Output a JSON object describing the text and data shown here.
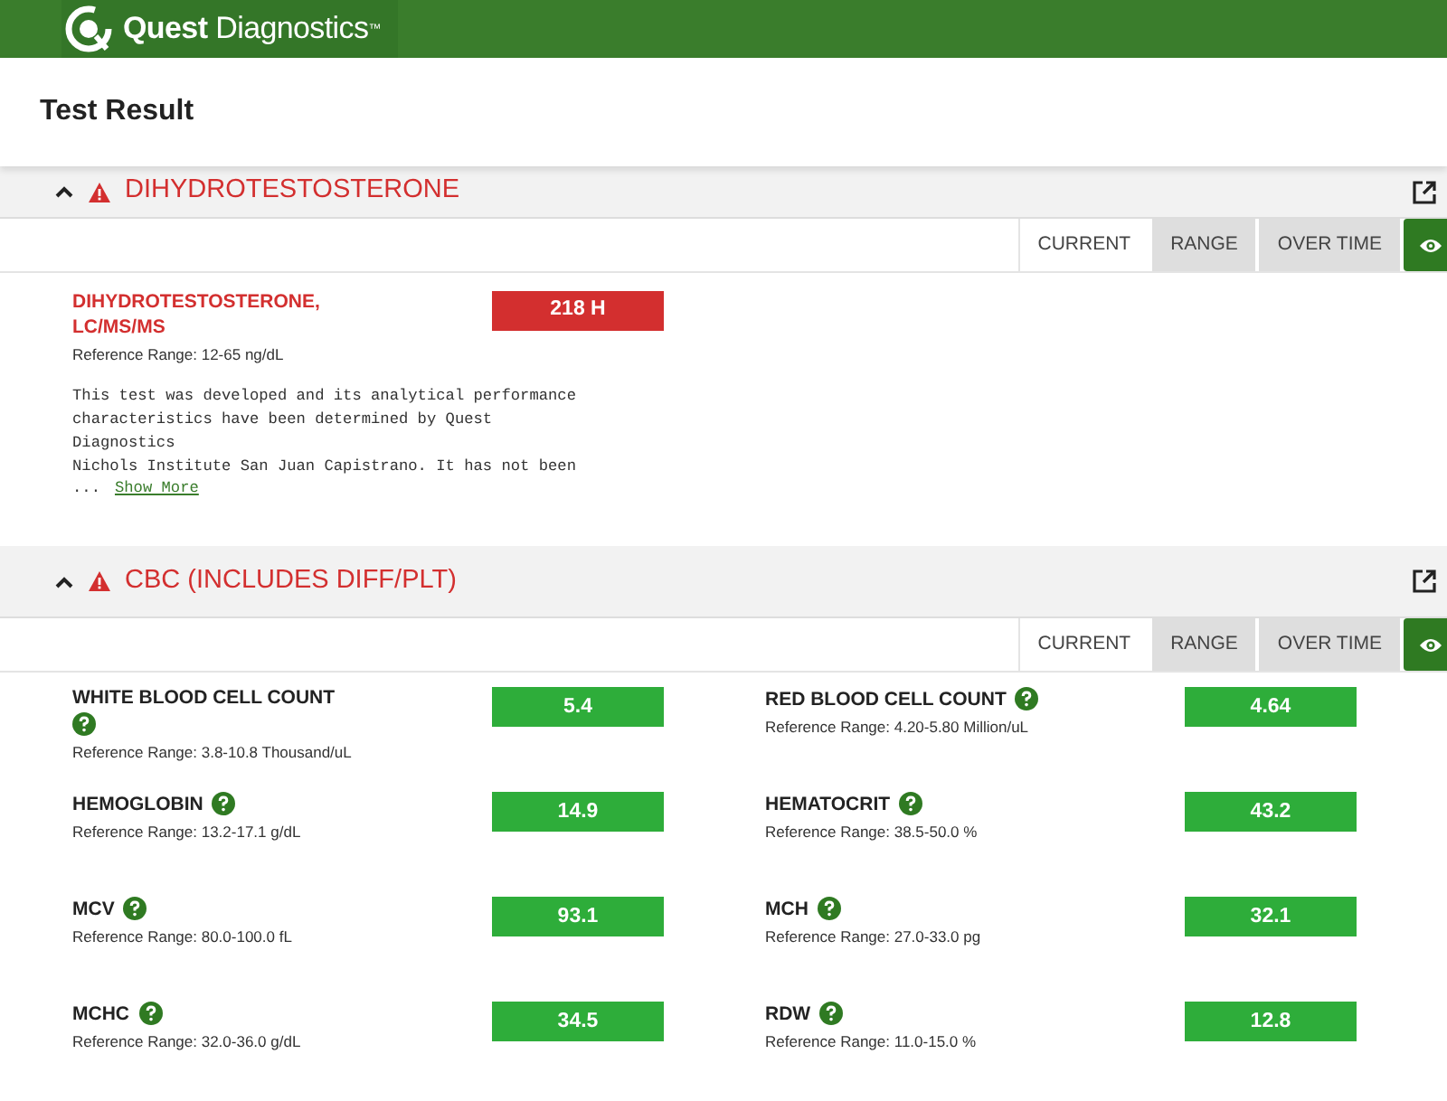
{
  "brand": {
    "logo_text": "**Quest** Diagnostics$^{™}$"
  },
  "page_title": "Test Result",
  "sections": [
    {
      "title": "DIHYDROTESTOSTERONE",
      "expanded": true,
      "alert": true,
      "tabs": [
        {
          "label": "CURRENT",
          "selected": true
        },
        {
          "label": "RANGE",
          "selected": false
        },
        {
          "label": "OVER TIME",
          "selected": false
        }
      ],
      "results": [
        {
          "name": "DIHYDROTESTOSTERONE, LC/MS/MS",
          "value": "218 H",
          "abnormal": true,
          "help": false,
          "reference": "Reference Range: 12-65 ng/dL",
          "note": "This test was developed and its analytical performance\ncharacteristics have been determined by Quest\nDiagnostics\nNichols Institute San Juan Capistrano. It has not been",
          "note_cut": "...",
          "note_link": "Show More"
        }
      ]
    },
    {
      "title": "CBC (INCLUDES DIFF/PLT)",
      "expanded": true,
      "alert": true,
      "tabs": [
        {
          "label": "CURRENT",
          "selected": true
        },
        {
          "label": "RANGE",
          "selected": false
        },
        {
          "label": "OVER TIME",
          "selected": false
        }
      ],
      "results": [
        {
          "name": "WHITE BLOOD CELL COUNT",
          "value": "5.4",
          "abnormal": false,
          "help": true,
          "reference": "Reference Range: 3.8-10.8 Thousand/uL"
        },
        {
          "name": "RED BLOOD CELL COUNT",
          "value": "4.64",
          "abnormal": false,
          "help": true,
          "reference": "Reference Range: 4.20-5.80 Million/uL"
        },
        {
          "name": "HEMOGLOBIN",
          "value": "14.9",
          "abnormal": false,
          "help": true,
          "reference": "Reference Range: 13.2-17.1 g/dL"
        },
        {
          "name": "HEMATOCRIT",
          "value": "43.2",
          "abnormal": false,
          "help": true,
          "reference": "Reference Range: 38.5-50.0 %"
        },
        {
          "name": "MCV",
          "value": "93.1",
          "abnormal": false,
          "help": true,
          "reference": "Reference Range: 80.0-100.0 fL"
        },
        {
          "name": "MCH",
          "value": "32.1",
          "abnormal": false,
          "help": true,
          "reference": "Reference Range: 27.0-33.0 pg"
        },
        {
          "name": "MCHC",
          "value": "34.5",
          "abnormal": false,
          "help": true,
          "reference": "Reference Range: 32.0-36.0 g/dL"
        },
        {
          "name": "RDW",
          "value": "12.8",
          "abnormal": false,
          "help": true,
          "reference": "Reference Range: 11.0-15.0 %"
        }
      ]
    }
  ]
}
